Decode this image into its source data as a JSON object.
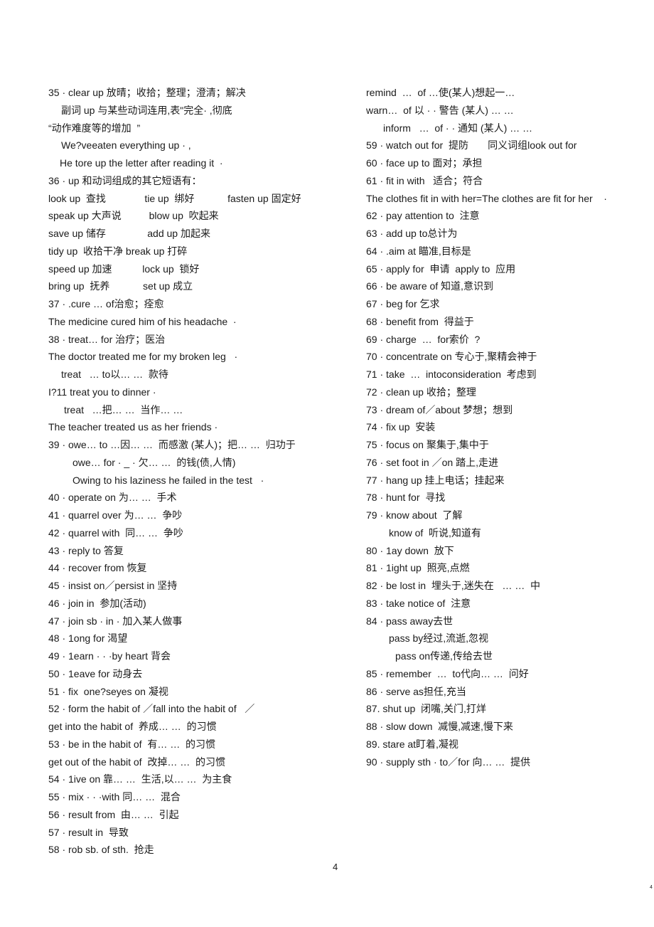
{
  "left_column": [
    "35 · clear up 放晴；收拾；整理；澄清；解决",
    "副词 up 与某些动词连用,表\"完全· ,彻底",
    "“动作难度等的增加  ”",
    "We?veeaten everything up · ,",
    "He tore up the letter after reading it  ·",
    "36 · up 和动词组成的其它短语有：",
    "look up  查找              tie up  绑好            fasten up 固定好",
    "speak up 大声说          blow up  吹起来",
    "save up 储存               add up 加起来",
    "tidy up  收拾干净 break up 打碎",
    "speed up 加速           lock up  锁好",
    "bring up  抚养            set up 成立",
    "37 · .cure … of治愈；痊愈",
    "The medicine cured him of his headache  ·",
    "38 · treat… for 治疗；医治",
    "The doctor treated me for my broken leg   ·",
    "treat   … to以… …  款待",
    "I?11 treat you to dinner ·",
    "treat   …把… …  当作… …",
    "The teacher treated us as her friends ·",
    "39 · owe… to …因… …  而感激 (某人)；把… …  归功于",
    "owe… for · _ · 欠… …  的钱(债,人情)",
    "Owing to his laziness he failed in the test   ·",
    "40 · operate on 为… …  手术",
    "41 · quarrel over 为… …  争吵",
    "42 · quarrel with  同… …  争吵",
    "43 · reply to 答复",
    "44 · recover from 恢复",
    "45 · insist on／persist in 坚持",
    "46 · join in  参加(活动)",
    "47 · join sb · in · 加入某人做事",
    "48 · 1ong for 渴望",
    "49 · 1earn · · ·by heart 背会",
    "50 · 1eave for 动身去",
    "51 · fix  one?seyes on 凝视",
    "52 · form the habit of ／fall into the habit of   ／",
    "get into the habit of  养成… …  的习惯",
    "53 · be in the habit of  有… …  的习惯",
    "get out of the habit of  改掉… …  的习惯",
    "54 · 1ive on 靠… …  生活,以… …  为主食",
    "55 · mix · · ·with 同… …  混合",
    "56 · result from  由… …  引起",
    "57 · result in  导致",
    "58 · rob sb. of sth.  抢走"
  ],
  "right_column": [
    "remind  …  of …使(某人)想起一…",
    "warn…  of 以 · · 警告 (某人) … …",
    "inform   …  of · · 通知 (某人) … …",
    "59 · watch out for  提防       同义词组look out for",
    "60 · face up to 面对；承担",
    "61 · fit in with   适合；符合",
    "The clothes fit in with her=The clothes are fit for her    ·",
    "62 · pay attention to  注意",
    "63 · add up to总计为",
    "64 · .aim at 瞄准,目标是",
    "65 · apply for  申请  apply to  应用",
    "66 · be aware of 知道,意识到",
    "67 · beg for 乞求",
    "68 · benefit from  得益于",
    "69 · charge  …  for索价  ?",
    "70 · concentrate on 专心于,聚精会神于",
    "71 · take  …  intoconsideration  考虑到",
    "72 · clean up 收拾；整理",
    "73 · dream of／about 梦想；想到",
    "74 · fix up  安装",
    "75 · focus on 聚集于,集中于",
    "76 · set foot in ／on 踏上,走进",
    "77 · hang up 挂上电话；挂起来",
    "78 · hunt for  寻找",
    "79 · know about  了解",
    "know of  听说,知道有",
    "80 · 1ay down  放下",
    "81 · 1ight up  照亮,点燃",
    "82 · be lost in  埋头于,迷失在   … …  中",
    "83 · take notice of  注意",
    "84 · pass away去世",
    "pass by经过,流逝,忽视",
    "pass on传递,传给去世",
    "85 · remember  …  to代向… …  问好",
    "86 · serve as担任,充当",
    "87. shut up  闭嘴,关门,打烊",
    "88 · slow down  减慢,减速,慢下来",
    "89. stare at盯着,凝视",
    "90 · supply sth · to／for 向… …  提供"
  ],
  "page_number": "4",
  "corner_mark": "4"
}
